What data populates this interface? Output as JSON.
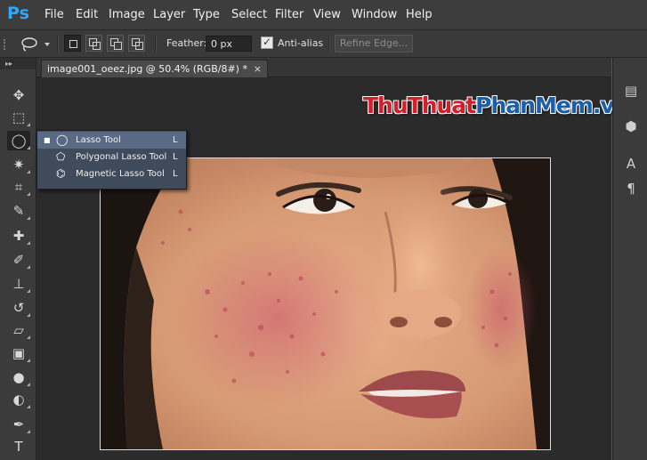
{
  "app": {
    "logo_text": "Ps"
  },
  "menu": [
    "File",
    "Edit",
    "Image",
    "Layer",
    "Type",
    "Select",
    "Filter",
    "View",
    "Window",
    "Help"
  ],
  "options_bar": {
    "feather_label": "Feather:",
    "feather_value": "0 px",
    "antialias_checked": true,
    "antialias_label": "Anti-alias",
    "refine_edge_label": "Refine Edge..."
  },
  "document_tab": {
    "title": "image001_oeez.jpg @ 50.4% (RGB/8#) *",
    "close_glyph": "×"
  },
  "tools": [
    {
      "name": "move-tool-icon",
      "glyph": "✥"
    },
    {
      "name": "marquee-tool-icon",
      "glyph": "⬚"
    },
    {
      "name": "lasso-tool-icon",
      "glyph": "◯"
    },
    {
      "name": "magic-wand-tool-icon",
      "glyph": "✷"
    },
    {
      "name": "crop-tool-icon",
      "glyph": "⌗"
    },
    {
      "name": "eyedropper-tool-icon",
      "glyph": "✎"
    },
    {
      "name": "healing-brush-tool-icon",
      "glyph": "✚"
    },
    {
      "name": "brush-tool-icon",
      "glyph": "✐"
    },
    {
      "name": "clone-stamp-tool-icon",
      "glyph": "⊥"
    },
    {
      "name": "history-brush-tool-icon",
      "glyph": "↺"
    },
    {
      "name": "eraser-tool-icon",
      "glyph": "▱"
    },
    {
      "name": "gradient-tool-icon",
      "glyph": "▣"
    },
    {
      "name": "blur-tool-icon",
      "glyph": "●"
    },
    {
      "name": "dodge-tool-icon",
      "glyph": "◐"
    },
    {
      "name": "pen-tool-icon",
      "glyph": "✒"
    },
    {
      "name": "type-tool-icon",
      "glyph": "T"
    }
  ],
  "lasso_flyout": [
    {
      "label": "Lasso Tool",
      "shortcut": "L",
      "selected": true,
      "icon": "lasso-icon"
    },
    {
      "label": "Polygonal Lasso Tool",
      "shortcut": "L",
      "selected": false,
      "icon": "polygonal-lasso-icon"
    },
    {
      "label": "Magnetic Lasso Tool",
      "shortcut": "L",
      "selected": false,
      "icon": "magnetic-lasso-icon"
    }
  ],
  "watermark": {
    "part1": "Thu",
    "part2": "Thuat",
    "part3": "Phan",
    "part4": "Mem",
    "part5": ".vn"
  },
  "colors": {
    "accent_blue": "#31a8ff",
    "menubar_bg": "#3d3d3d",
    "flyout_bg": "#3f4a5a"
  }
}
